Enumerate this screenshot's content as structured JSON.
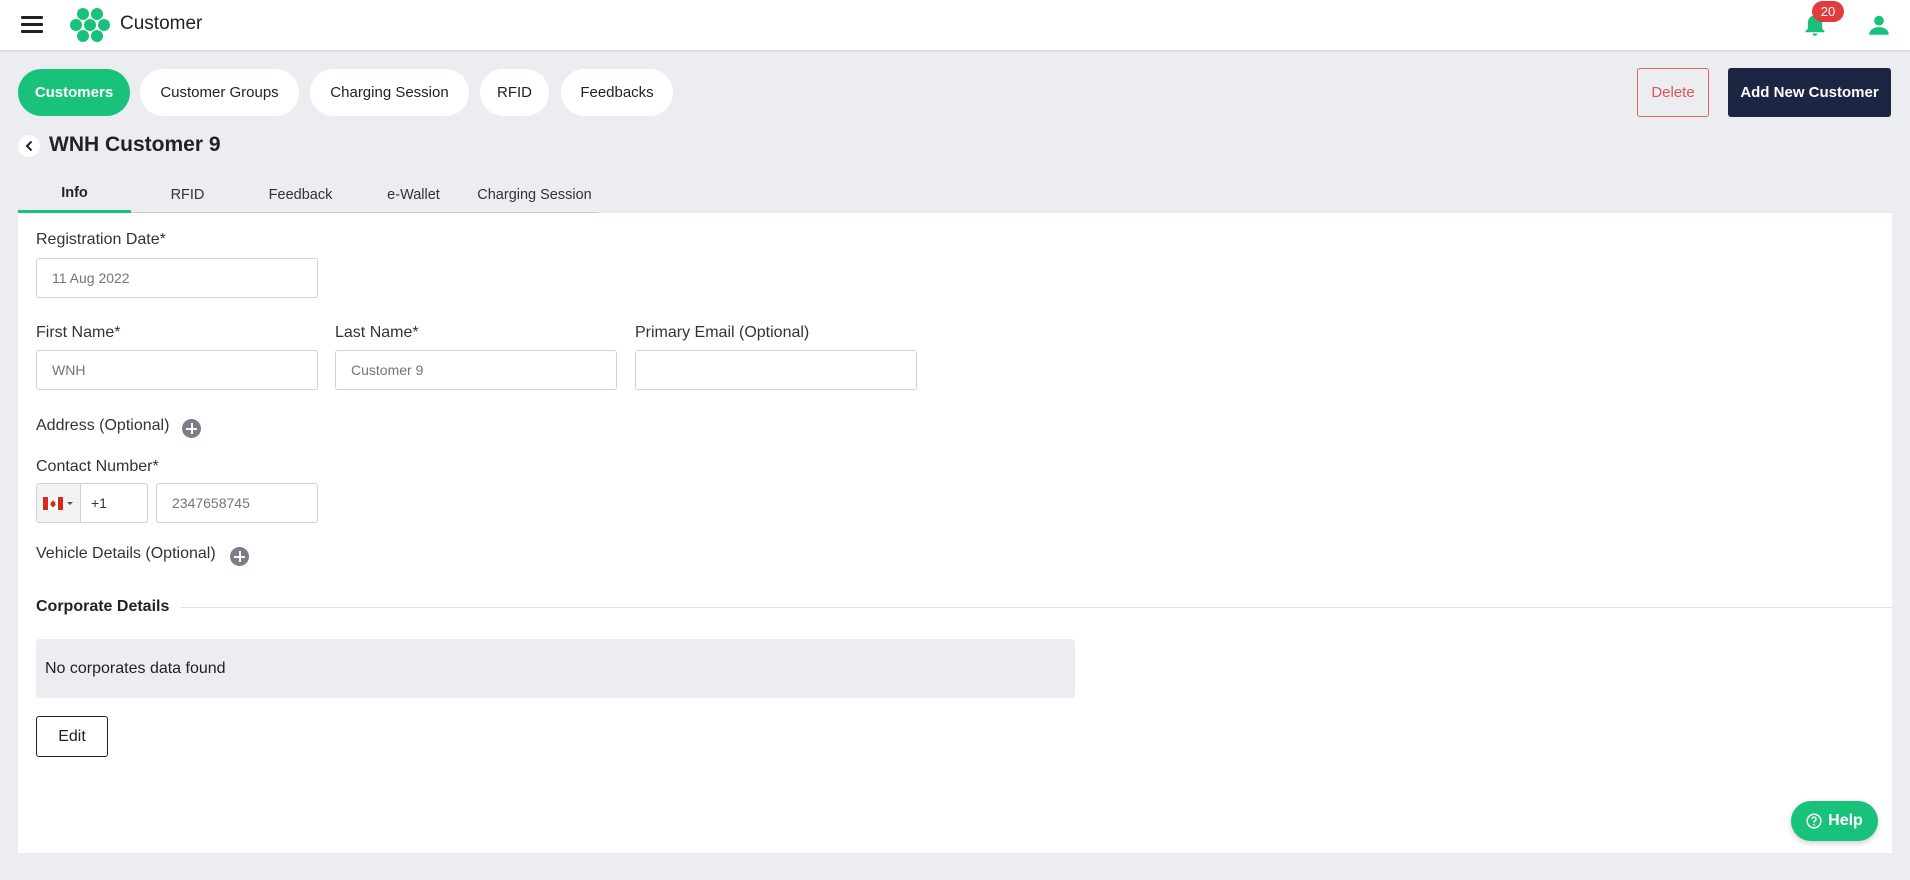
{
  "header": {
    "title": "Customer",
    "notification_count": "20",
    "colors": {
      "accent": "#19c27a",
      "dark": "#1c2541",
      "danger": "#e03c3c"
    }
  },
  "pills": [
    {
      "label": "Customers",
      "active": true
    },
    {
      "label": "Customer Groups",
      "active": false
    },
    {
      "label": "Charging Session",
      "active": false
    },
    {
      "label": "RFID",
      "active": false
    },
    {
      "label": "Feedbacks",
      "active": false
    }
  ],
  "actions": {
    "delete_label": "Delete",
    "add_label": "Add New Customer"
  },
  "page": {
    "title": "WNH Customer 9"
  },
  "subtabs": [
    {
      "label": "Info",
      "active": true
    },
    {
      "label": "RFID",
      "active": false
    },
    {
      "label": "Feedback",
      "active": false
    },
    {
      "label": "e-Wallet",
      "active": false
    },
    {
      "label": "Charging Session",
      "active": false
    }
  ],
  "form": {
    "registration_date": {
      "label": "Registration Date*",
      "placeholder": "11 Aug 2022"
    },
    "first_name": {
      "label": "First Name*",
      "placeholder": "WNH"
    },
    "last_name": {
      "label": "Last Name*",
      "placeholder": "Customer 9"
    },
    "email": {
      "label": "Primary Email (Optional)",
      "placeholder": ""
    },
    "address": {
      "label": "Address (Optional)"
    },
    "contact": {
      "label": "Contact Number*",
      "country": "CA",
      "dial_code": "+1",
      "placeholder": "2347658745"
    },
    "vehicle": {
      "label": "Vehicle Details (Optional)"
    }
  },
  "corporate": {
    "title": "Corporate Details",
    "empty_text": "No corporates data found",
    "edit_label": "Edit"
  },
  "help": {
    "label": "Help"
  }
}
